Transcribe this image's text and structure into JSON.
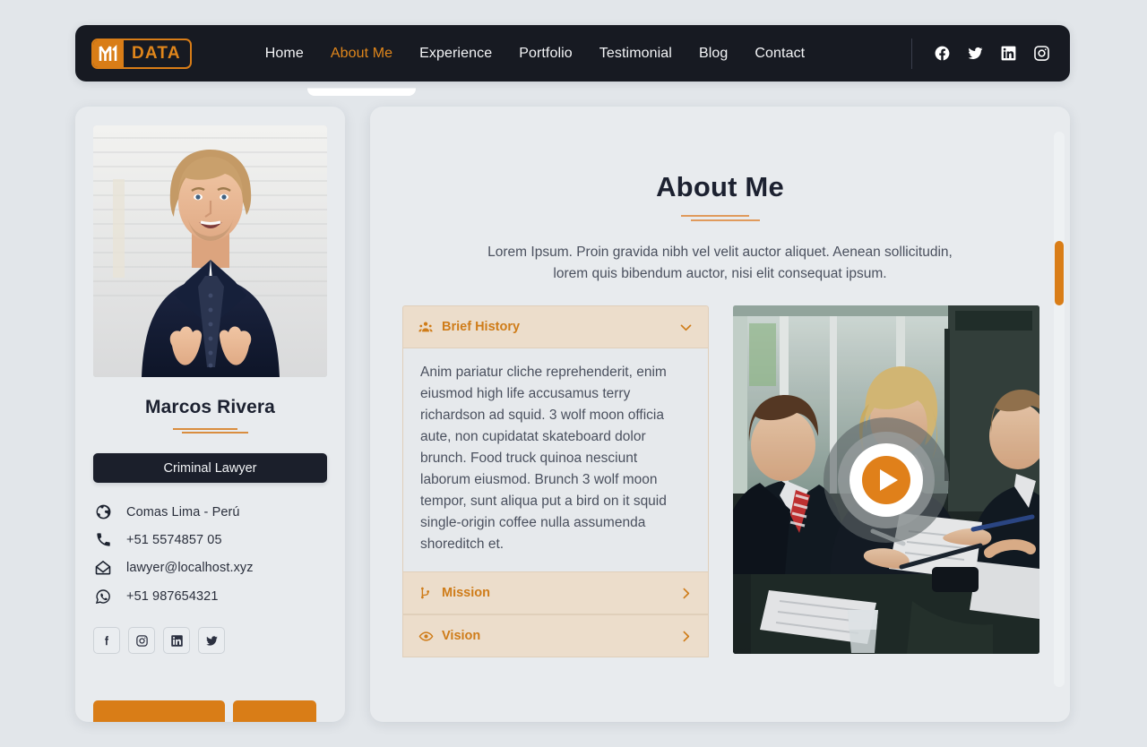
{
  "navbar": {
    "logo": {
      "mark_icon": "m-monogram-icon",
      "text": "DATA"
    },
    "links": [
      {
        "label": "Home",
        "active": false
      },
      {
        "label": "About Me",
        "active": true
      },
      {
        "label": "Experience",
        "active": false
      },
      {
        "label": "Portfolio",
        "active": false
      },
      {
        "label": "Testimonial",
        "active": false
      },
      {
        "label": "Blog",
        "active": false
      },
      {
        "label": "Contact",
        "active": false
      }
    ],
    "socials": [
      {
        "name": "facebook-icon"
      },
      {
        "name": "twitter-icon"
      },
      {
        "name": "linkedin-icon"
      },
      {
        "name": "instagram-icon"
      }
    ]
  },
  "profile": {
    "photo_alt": "portrait-photo",
    "name": "Marcos Rivera",
    "role": "Criminal Lawyer",
    "contacts": [
      {
        "icon": "globe-icon",
        "text": "Comas Lima - Perú"
      },
      {
        "icon": "phone-icon",
        "text": "+51 5574857 05"
      },
      {
        "icon": "envelope-icon",
        "text": "lawyer@localhost.xyz"
      },
      {
        "icon": "whatsapp-icon",
        "text": "+51 987654321"
      }
    ],
    "socials": [
      {
        "name": "facebook-icon"
      },
      {
        "name": "instagram-icon"
      },
      {
        "name": "linkedin-icon"
      },
      {
        "name": "twitter-icon"
      }
    ]
  },
  "about": {
    "title": "About Me",
    "subtitle": "Lorem Ipsum. Proin gravida nibh vel velit auctor aliquet. Aenean sollicitudin, lorem quis bibendum auctor, nisi elit consequat ipsum.",
    "panels": [
      {
        "label": "Brief History",
        "icon": "users-icon",
        "expanded": true,
        "chevron": "chevron-down-icon",
        "body": "Anim pariatur cliche reprehenderit, enim eiusmod high life accusamus terry richardson ad squid. 3 wolf moon officia aute, non cupidatat skateboard dolor brunch. Food truck quinoa nesciunt laborum eiusmod. Brunch 3 wolf moon tempor, sunt aliqua put a bird on it squid single-origin coffee nulla assumenda shoreditch et."
      },
      {
        "label": "Mission",
        "icon": "flag-branch-icon",
        "expanded": false,
        "chevron": "chevron-right-icon",
        "body": ""
      },
      {
        "label": "Vision",
        "icon": "eye-icon",
        "expanded": false,
        "chevron": "chevron-right-icon",
        "body": ""
      }
    ],
    "video": {
      "alt": "business-meeting-photo",
      "play_icon": "play-icon"
    }
  },
  "colors": {
    "accent": "#d97d17",
    "accent_light": "#e0861b",
    "dark": "#171a22",
    "page_bg": "#e2e6ea",
    "card_bg": "#e8ebee",
    "panel_head_bg": "#ecddcb"
  }
}
